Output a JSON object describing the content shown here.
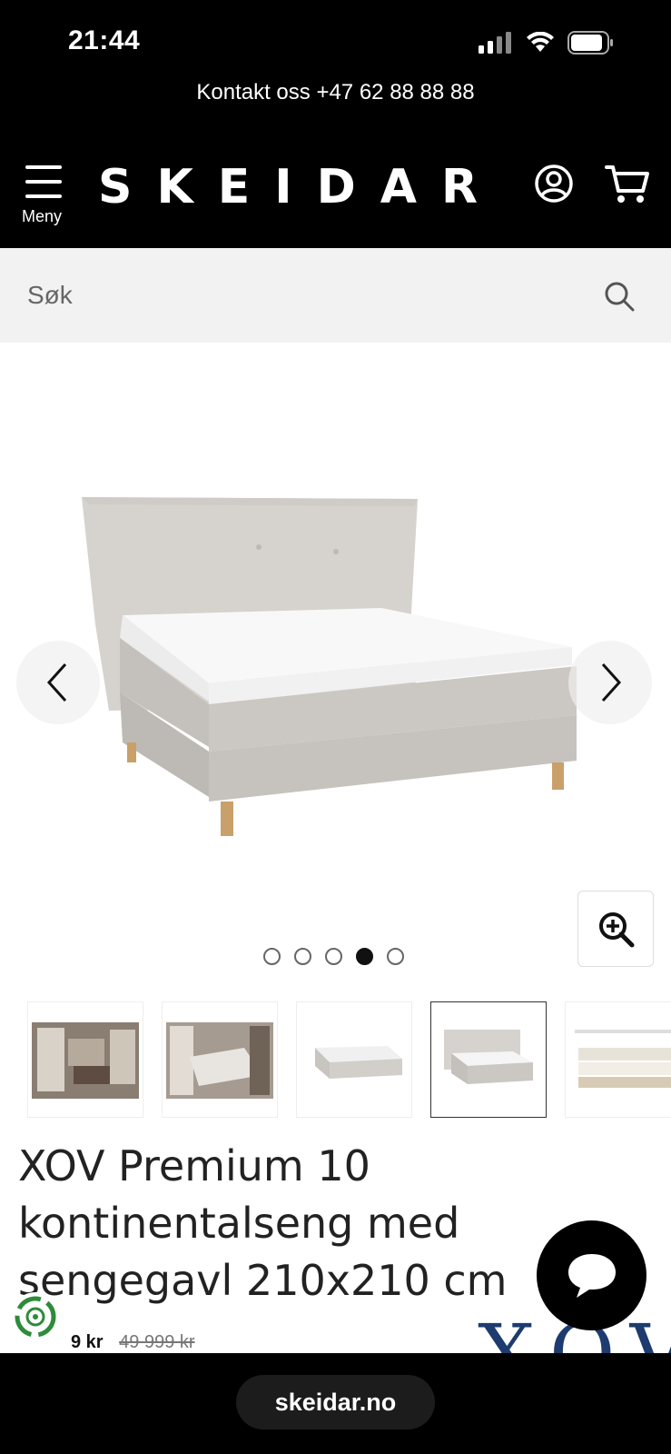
{
  "status": {
    "time": "21:44"
  },
  "contact": {
    "text": "Kontakt oss +47 62 88 88 88"
  },
  "header": {
    "logo": "SKEIDAR",
    "menu_label": "Meny",
    "icons": {
      "menu": "hamburger-menu-icon",
      "account": "user-circle-icon",
      "cart": "shopping-cart-icon"
    }
  },
  "search": {
    "placeholder": "Søk"
  },
  "gallery": {
    "image_count": 5,
    "active_index": 3,
    "thumbnails": [
      "bedroom-scene-1",
      "bedroom-scene-2",
      "bed-photo",
      "bed-with-headboard",
      "mattress-diagram"
    ]
  },
  "product": {
    "title": "XOV Premium 10 kontinentalseng med sengegavl 210x210 cm",
    "price_now": "9 kr",
    "price_old": "49 999 kr",
    "brand_mark": "XOV"
  },
  "browser": {
    "url": "skeidar.no"
  },
  "colors": {
    "header_bg": "#000000",
    "search_bg": "#f2f2f2",
    "brand_blue": "#1d3b6e"
  }
}
